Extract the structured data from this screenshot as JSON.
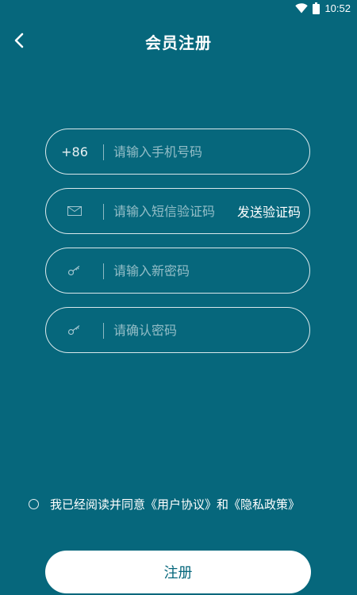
{
  "status_bar": {
    "time": "10:52",
    "icons": [
      "wifi-icon",
      "battery-icon"
    ]
  },
  "header": {
    "title": "会员注册",
    "back_icon": "chevron-left-icon"
  },
  "form": {
    "phone": {
      "prefix": "+86",
      "placeholder": "请输入手机号码",
      "value": ""
    },
    "code": {
      "icon": "mail-icon",
      "placeholder": "请输入短信验证码",
      "value": "",
      "send_label": "发送验证码"
    },
    "new_password": {
      "icon": "key-icon",
      "placeholder": "请输入新密码",
      "value": ""
    },
    "confirm_password": {
      "icon": "key-icon",
      "placeholder": "请确认密码",
      "value": ""
    }
  },
  "agreement": {
    "checked": false,
    "prefix": "我已经阅读并同意",
    "user_agreement": "《用户协议》",
    "conjunction": "和",
    "privacy_policy": "《隐私政策》"
  },
  "submit_label": "注册",
  "colors": {
    "background": "#06677c",
    "foreground": "#ffffff"
  }
}
